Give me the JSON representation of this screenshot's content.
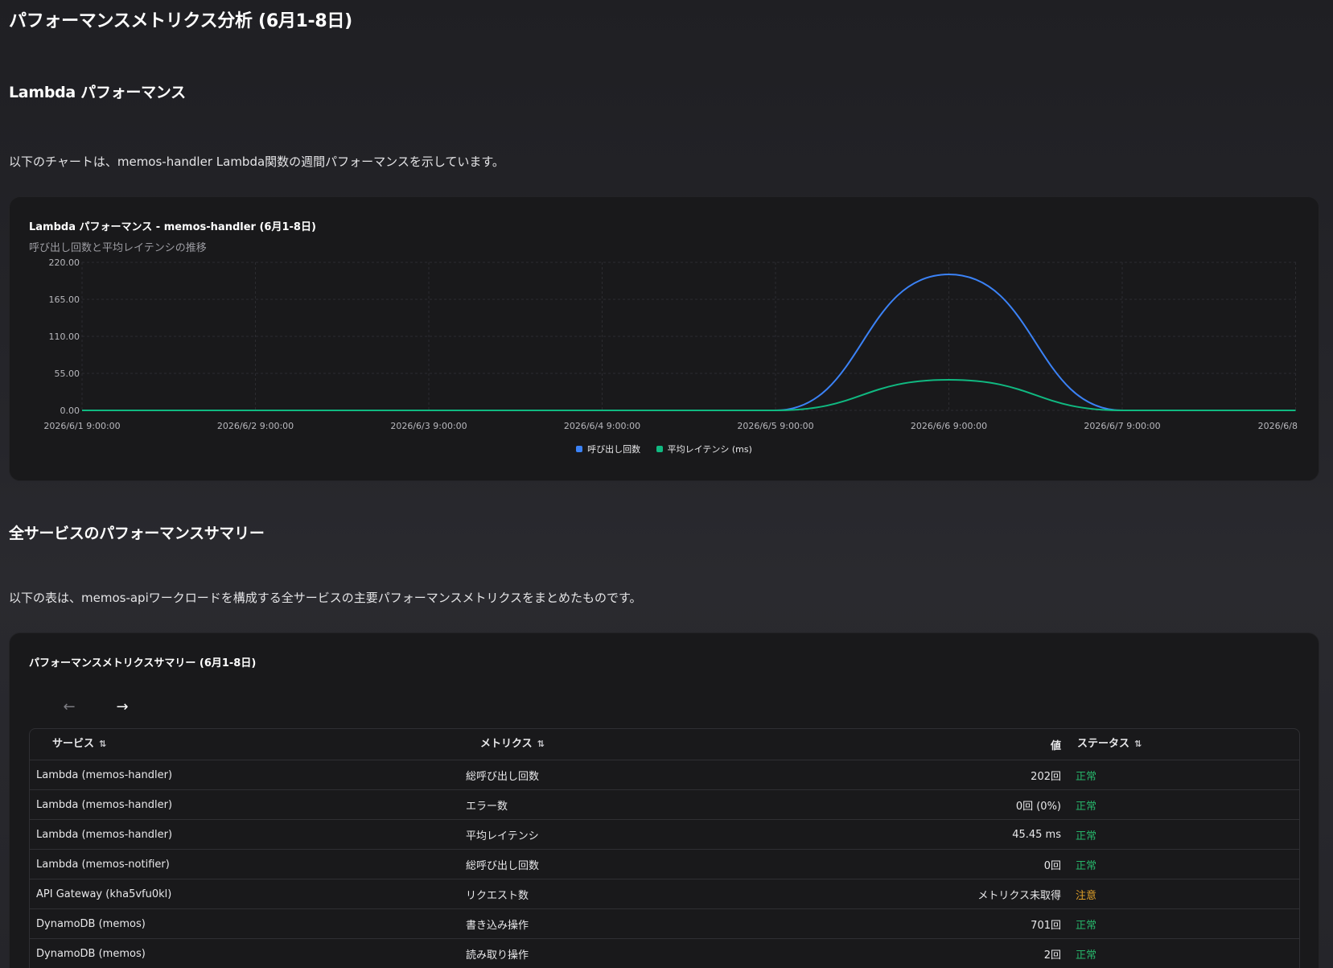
{
  "page_title": "パフォーマンスメトリクス分析 (6月1-8日)",
  "section1": {
    "heading": "Lambda パフォーマンス",
    "description": "以下のチャートは、memos-handler Lambda関数の週間パフォーマンスを示しています。"
  },
  "chart_card": {
    "title": "Lambda パフォーマンス - memos-handler (6月1-8日)",
    "subtitle": "呼び出し回数と平均レイテンシの推移"
  },
  "chart_data": {
    "type": "line",
    "title": "Lambda パフォーマンス - memos-handler (6月1-8日)",
    "subtitle": "呼び出し回数と平均レイテンシの推移",
    "x": [
      "2026/6/1 9:00:00",
      "2026/6/2 9:00:00",
      "2026/6/3 9:00:00",
      "2026/6/4 9:00:00",
      "2026/6/5 9:00:00",
      "2026/6/6 9:00:00",
      "2026/6/7 9:00:00",
      "2026/6/8"
    ],
    "y_ticks": [
      "0.00",
      "55.00",
      "110.00",
      "165.00",
      "220.00"
    ],
    "ylim": [
      0,
      220
    ],
    "grid": true,
    "legend_position": "bottom-center",
    "series": [
      {
        "name": "呼び出し回数",
        "color": "#3b82f6",
        "values": [
          0,
          0,
          0,
          0,
          0,
          202,
          0,
          0
        ]
      },
      {
        "name": "平均レイテンシ (ms)",
        "color": "#10b981",
        "values": [
          0,
          0,
          0,
          0,
          0,
          45.45,
          0,
          0
        ]
      }
    ]
  },
  "section2": {
    "heading": "全サービスのパフォーマンスサマリー",
    "description": "以下の表は、memos-apiワークロードを構成する全サービスの主要パフォーマンスメトリクスをまとめたものです。"
  },
  "table_card": {
    "title": "パフォーマンスメトリクスサマリー (6月1-8日)",
    "pager": {
      "prev_icon": "←",
      "next_icon": "→"
    },
    "columns": {
      "service": "サービス",
      "metric": "メトリクス",
      "value": "値",
      "status": "ステータス",
      "sort_icon": "⇅"
    },
    "rows": [
      {
        "service": "Lambda (memos-handler)",
        "metric": "総呼び出し回数",
        "value": "202回",
        "status": "正常",
        "status_type": "ok"
      },
      {
        "service": "Lambda (memos-handler)",
        "metric": "エラー数",
        "value": "0回 (0%)",
        "status": "正常",
        "status_type": "ok"
      },
      {
        "service": "Lambda (memos-handler)",
        "metric": "平均レイテンシ",
        "value": "45.45 ms",
        "status": "正常",
        "status_type": "ok"
      },
      {
        "service": "Lambda (memos-notifier)",
        "metric": "総呼び出し回数",
        "value": "0回",
        "status": "正常",
        "status_type": "ok"
      },
      {
        "service": "API Gateway (kha5vfu0kl)",
        "metric": "リクエスト数",
        "value": "メトリクス未取得",
        "status": "注意",
        "status_type": "warn"
      },
      {
        "service": "DynamoDB (memos)",
        "metric": "書き込み操作",
        "value": "701回",
        "status": "正常",
        "status_type": "ok"
      },
      {
        "service": "DynamoDB (memos)",
        "metric": "読み取り操作",
        "value": "2回",
        "status": "正常",
        "status_type": "ok"
      }
    ]
  }
}
